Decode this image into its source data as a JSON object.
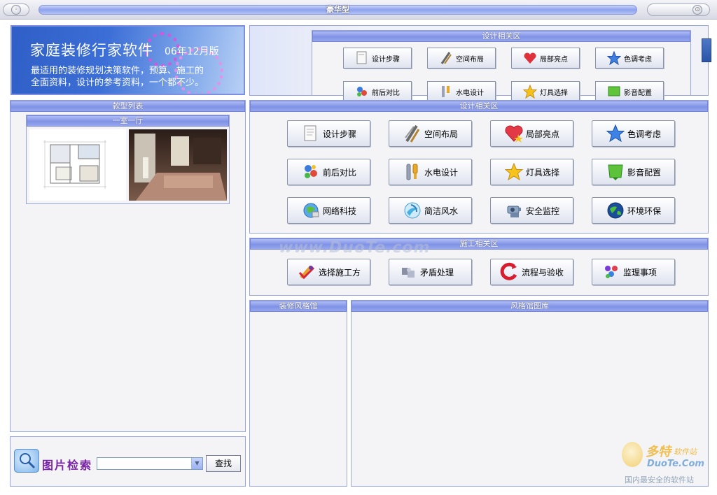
{
  "window": {
    "title": "豪华型"
  },
  "banner": {
    "title": "家庭装修行家软件",
    "version": "06年12月版",
    "line1": "最适用的装修规划决策软件，预算、施工的",
    "line2": "全面资料，设计的参考资料，一个都不少。"
  },
  "layout_list": {
    "header": "款型列表",
    "item_title": "一室一厅"
  },
  "top_panel": {
    "header": "设计相关区",
    "buttons": [
      "设计步骤",
      "空间布局",
      "局部亮点",
      "色调考虑",
      "前后对比",
      "水电设计",
      "灯具选择",
      "影音配置"
    ]
  },
  "design_panel": {
    "header": "设计相关区",
    "buttons": [
      "设计步骤",
      "空间布局",
      "局部亮点",
      "色调考虑",
      "前后对比",
      "水电设计",
      "灯具选择",
      "影音配置",
      "网络科技",
      "简洁风水",
      "安全监控",
      "环境环保"
    ]
  },
  "construction_panel": {
    "header": "施工相关区",
    "buttons": [
      "选择施工方",
      "矛盾处理",
      "流程与验收",
      "监理事项"
    ]
  },
  "style_panel": {
    "header": "装修风格馆"
  },
  "gallery_panel": {
    "header": "风格馆图库"
  },
  "search": {
    "label": "图片检索",
    "button": "查找",
    "value": ""
  },
  "watermarks": {
    "center": "www.DuoTe.com",
    "brand": "多特",
    "brand_sub": "软件站",
    "site": "DuoTe.Com",
    "slogan": "国内最安全的软件站"
  },
  "colors": {
    "header_blue": "#8092e6",
    "panel_border": "#98a6dd",
    "banner_blue": "#3b6ed6"
  }
}
